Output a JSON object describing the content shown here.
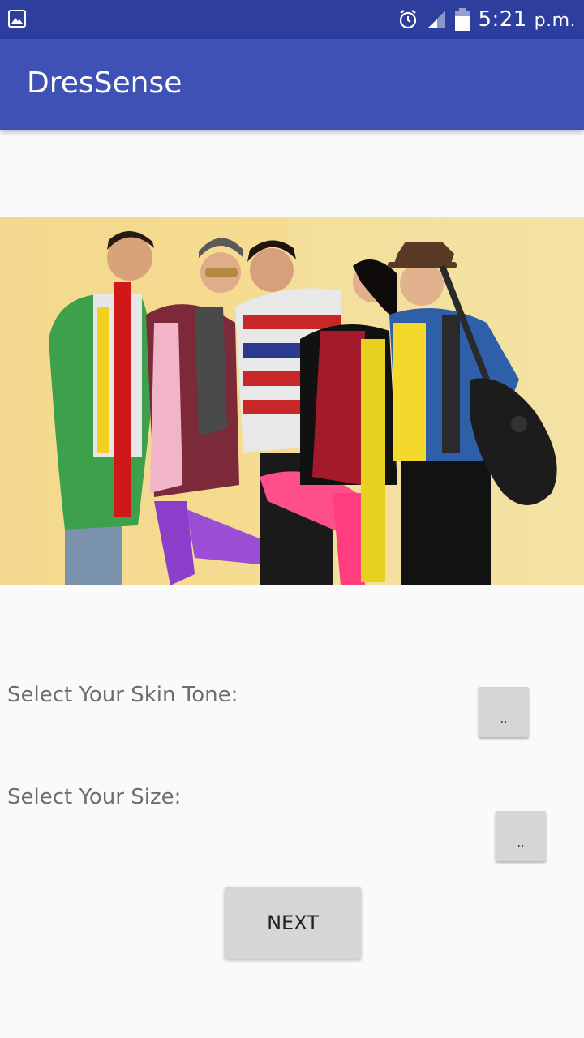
{
  "status_bar": {
    "time": "5:21",
    "ampm": "p.m.",
    "icons": [
      "gallery-icon",
      "alarm-icon",
      "signal-icon",
      "battery-icon"
    ],
    "color": "#2e3e9e"
  },
  "app_bar": {
    "title": "DresSense",
    "color": "#3f51b5"
  },
  "hero": {
    "description_icon": "fashion-group-photo"
  },
  "form": {
    "skin_tone_label": "Select Your Skin Tone:",
    "skin_tone_button": "..",
    "size_label": "Select Your Size:",
    "size_button": ".."
  },
  "next_button": "NEXT"
}
